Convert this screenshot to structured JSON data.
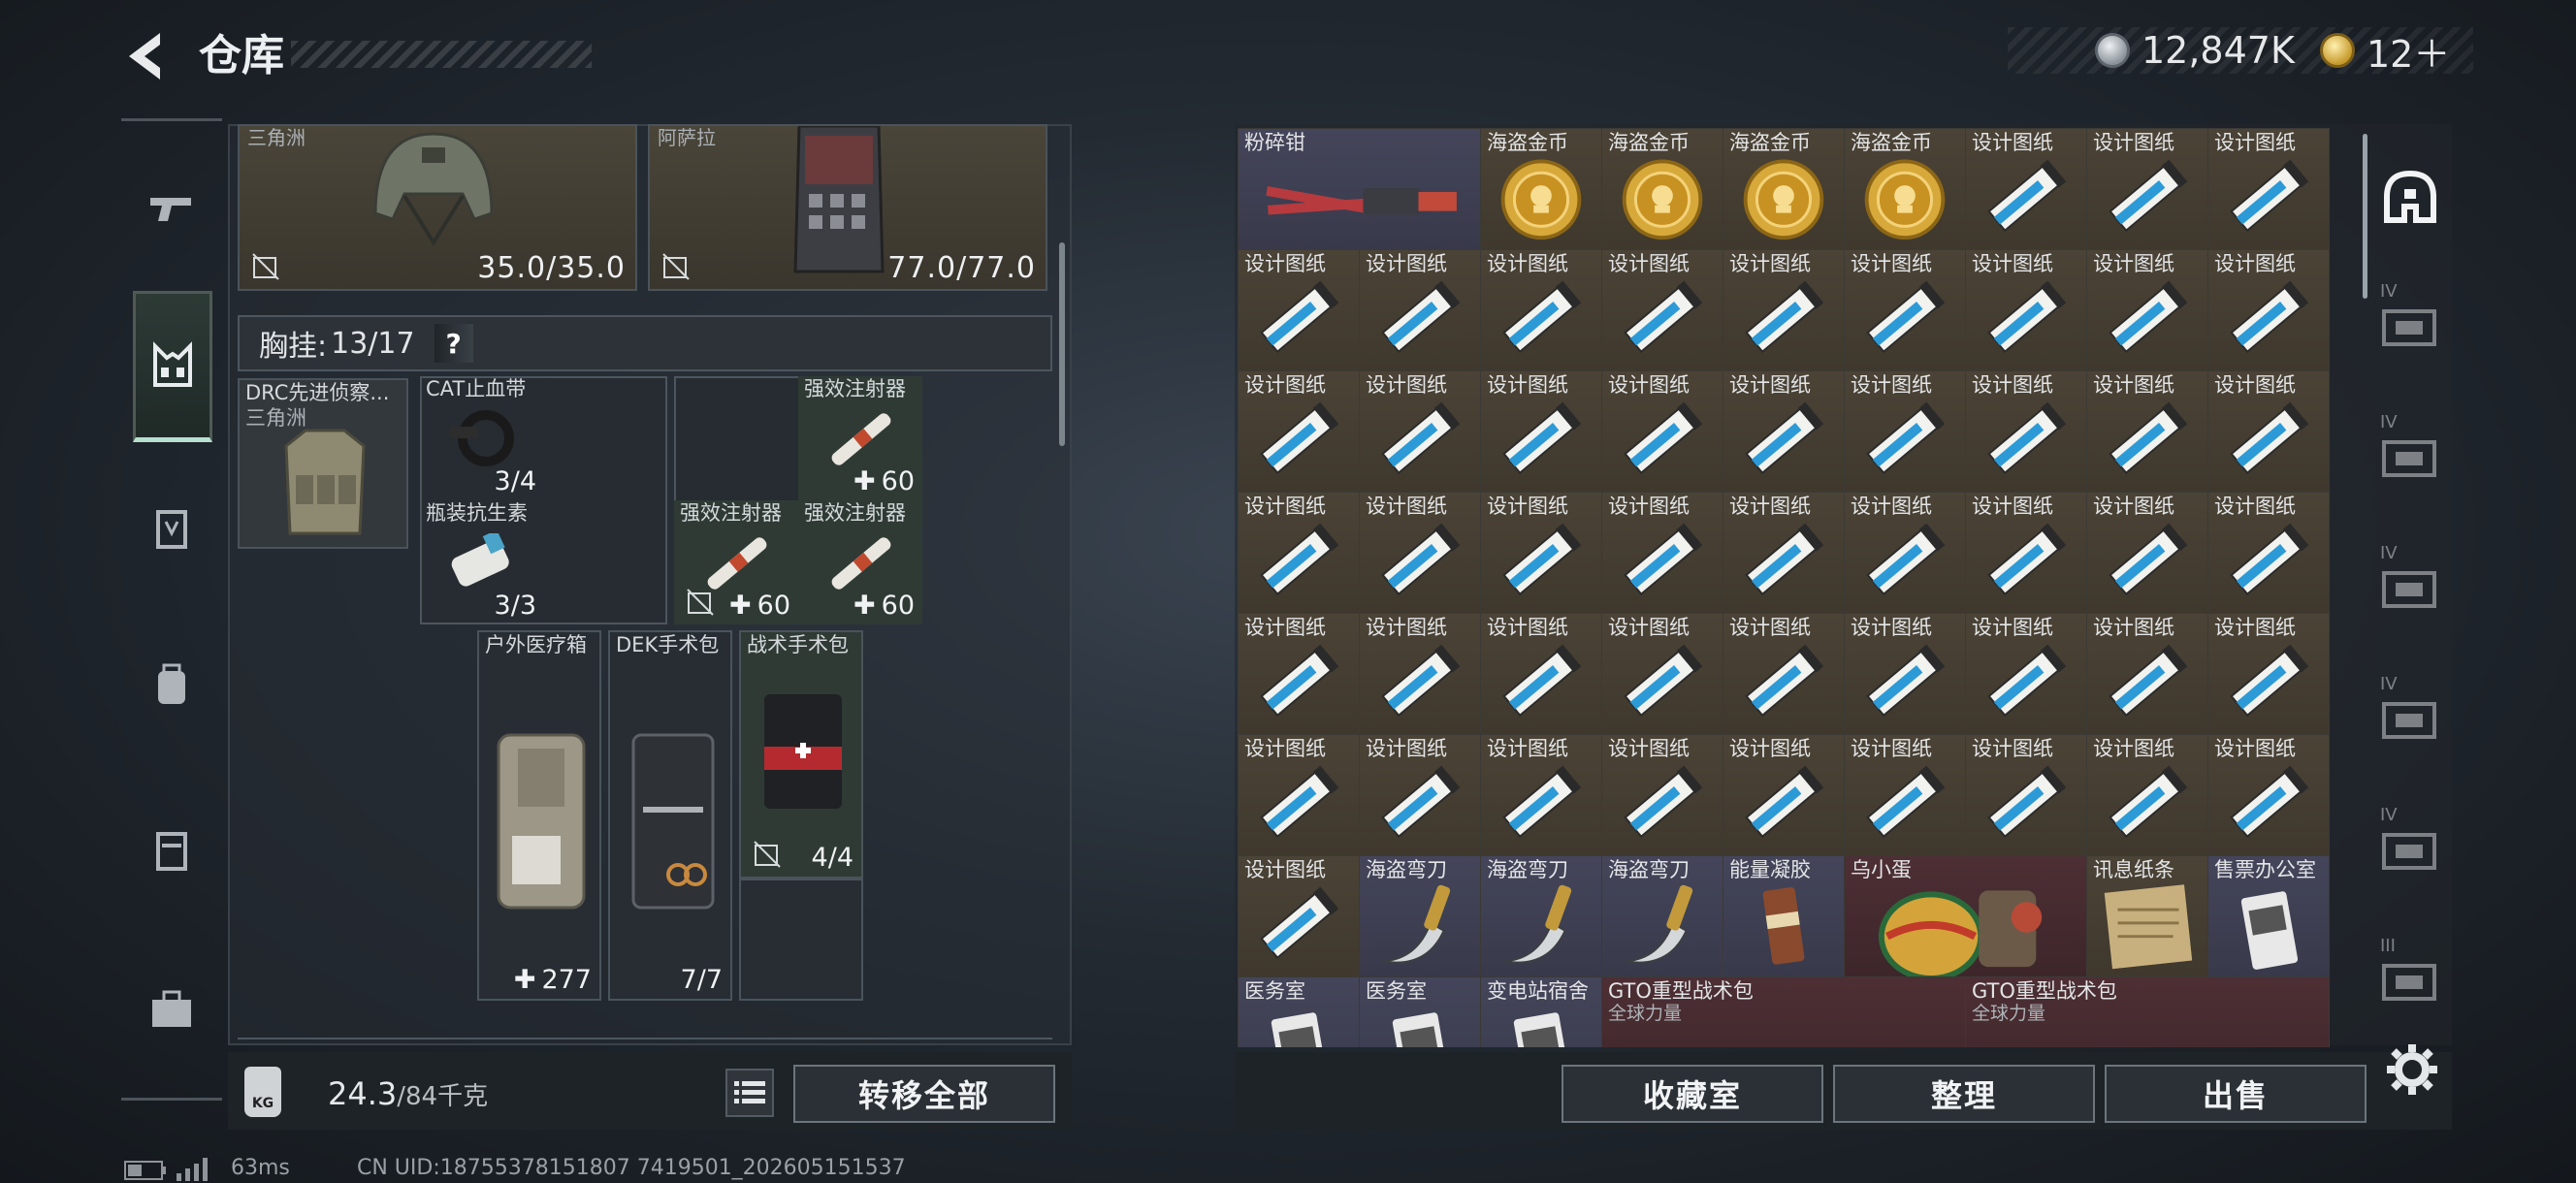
{
  "header": {
    "title": "仓库",
    "currency_silver": "12,847K",
    "currency_gold": "12＋"
  },
  "gear": {
    "helmet_map": "三角洲",
    "helmet_durability": "35.0/35.0",
    "armor_map": "阿萨拉",
    "armor_durability": "77.0/77.0"
  },
  "chest": {
    "header_label": "胸挂:",
    "header_capacity": "13/17",
    "help": "?",
    "rig_name": "DRC先进侦察...",
    "rig_map": "三角洲"
  },
  "items": {
    "cat_name": "CAT止血带",
    "cat_count": "3/4",
    "inj1_name": "强效注射器",
    "inj1_count": "60",
    "antibiotic_name": "瓶装抗生素",
    "antibiotic_count": "3/3",
    "inj2_name": "强效注射器",
    "inj2_count": "60",
    "inj3_name": "强效注射器",
    "inj3_count": "60",
    "medkit_name": "户外医疗箱",
    "medkit_count": "277",
    "dek_name": "DEK手术包",
    "dek_count": "7/7",
    "tactical_name": "战术手术包",
    "tactical_count": "4/4"
  },
  "bottom": {
    "weight_icon": "KG",
    "weight_current": "24.3",
    "weight_max": "/84千克",
    "transfer_all": "转移全部"
  },
  "storage": {
    "cells": [
      {
        "r": 0,
        "c": 0,
        "w": 2,
        "label": "粉碎钳",
        "icon": "crusher",
        "bg": "purple"
      },
      {
        "r": 0,
        "c": 2,
        "label": "海盗金币",
        "icon": "coin"
      },
      {
        "r": 0,
        "c": 3,
        "label": "海盗金币",
        "icon": "coin"
      },
      {
        "r": 0,
        "c": 4,
        "label": "海盗金币",
        "icon": "coin"
      },
      {
        "r": 0,
        "c": 5,
        "label": "海盗金币",
        "icon": "coin"
      },
      {
        "r": 0,
        "c": 6,
        "label": "设计图纸",
        "icon": "blueprint"
      },
      {
        "r": 0,
        "c": 7,
        "label": "设计图纸",
        "icon": "blueprint"
      },
      {
        "r": 0,
        "c": 8,
        "label": "设计图纸",
        "icon": "blueprint"
      },
      {
        "r": 1,
        "c": 0,
        "label": "设计图纸",
        "icon": "blueprint"
      },
      {
        "r": 1,
        "c": 1,
        "label": "设计图纸",
        "icon": "blueprint"
      },
      {
        "r": 1,
        "c": 2,
        "label": "设计图纸",
        "icon": "blueprint"
      },
      {
        "r": 1,
        "c": 3,
        "label": "设计图纸",
        "icon": "blueprint"
      },
      {
        "r": 1,
        "c": 4,
        "label": "设计图纸",
        "icon": "blueprint"
      },
      {
        "r": 1,
        "c": 5,
        "label": "设计图纸",
        "icon": "blueprint"
      },
      {
        "r": 1,
        "c": 6,
        "label": "设计图纸",
        "icon": "blueprint"
      },
      {
        "r": 1,
        "c": 7,
        "label": "设计图纸",
        "icon": "blueprint"
      },
      {
        "r": 1,
        "c": 8,
        "label": "设计图纸",
        "icon": "blueprint"
      },
      {
        "r": 2,
        "c": 0,
        "label": "设计图纸",
        "icon": "blueprint"
      },
      {
        "r": 2,
        "c": 1,
        "label": "设计图纸",
        "icon": "blueprint"
      },
      {
        "r": 2,
        "c": 2,
        "label": "设计图纸",
        "icon": "blueprint"
      },
      {
        "r": 2,
        "c": 3,
        "label": "设计图纸",
        "icon": "blueprint"
      },
      {
        "r": 2,
        "c": 4,
        "label": "设计图纸",
        "icon": "blueprint"
      },
      {
        "r": 2,
        "c": 5,
        "label": "设计图纸",
        "icon": "blueprint"
      },
      {
        "r": 2,
        "c": 6,
        "label": "设计图纸",
        "icon": "blueprint"
      },
      {
        "r": 2,
        "c": 7,
        "label": "设计图纸",
        "icon": "blueprint"
      },
      {
        "r": 2,
        "c": 8,
        "label": "设计图纸",
        "icon": "blueprint"
      },
      {
        "r": 3,
        "c": 0,
        "label": "设计图纸",
        "icon": "blueprint"
      },
      {
        "r": 3,
        "c": 1,
        "label": "设计图纸",
        "icon": "blueprint"
      },
      {
        "r": 3,
        "c": 2,
        "label": "设计图纸",
        "icon": "blueprint"
      },
      {
        "r": 3,
        "c": 3,
        "label": "设计图纸",
        "icon": "blueprint"
      },
      {
        "r": 3,
        "c": 4,
        "label": "设计图纸",
        "icon": "blueprint"
      },
      {
        "r": 3,
        "c": 5,
        "label": "设计图纸",
        "icon": "blueprint"
      },
      {
        "r": 3,
        "c": 6,
        "label": "设计图纸",
        "icon": "blueprint"
      },
      {
        "r": 3,
        "c": 7,
        "label": "设计图纸",
        "icon": "blueprint"
      },
      {
        "r": 3,
        "c": 8,
        "label": "设计图纸",
        "icon": "blueprint"
      },
      {
        "r": 4,
        "c": 0,
        "label": "设计图纸",
        "icon": "blueprint"
      },
      {
        "r": 4,
        "c": 1,
        "label": "设计图纸",
        "icon": "blueprint"
      },
      {
        "r": 4,
        "c": 2,
        "label": "设计图纸",
        "icon": "blueprint"
      },
      {
        "r": 4,
        "c": 3,
        "label": "设计图纸",
        "icon": "blueprint"
      },
      {
        "r": 4,
        "c": 4,
        "label": "设计图纸",
        "icon": "blueprint"
      },
      {
        "r": 4,
        "c": 5,
        "label": "设计图纸",
        "icon": "blueprint"
      },
      {
        "r": 4,
        "c": 6,
        "label": "设计图纸",
        "icon": "blueprint"
      },
      {
        "r": 4,
        "c": 7,
        "label": "设计图纸",
        "icon": "blueprint"
      },
      {
        "r": 4,
        "c": 8,
        "label": "设计图纸",
        "icon": "blueprint"
      },
      {
        "r": 5,
        "c": 0,
        "label": "设计图纸",
        "icon": "blueprint"
      },
      {
        "r": 5,
        "c": 1,
        "label": "设计图纸",
        "icon": "blueprint"
      },
      {
        "r": 5,
        "c": 2,
        "label": "设计图纸",
        "icon": "blueprint"
      },
      {
        "r": 5,
        "c": 3,
        "label": "设计图纸",
        "icon": "blueprint"
      },
      {
        "r": 5,
        "c": 4,
        "label": "设计图纸",
        "icon": "blueprint"
      },
      {
        "r": 5,
        "c": 5,
        "label": "设计图纸",
        "icon": "blueprint"
      },
      {
        "r": 5,
        "c": 6,
        "label": "设计图纸",
        "icon": "blueprint"
      },
      {
        "r": 5,
        "c": 7,
        "label": "设计图纸",
        "icon": "blueprint"
      },
      {
        "r": 5,
        "c": 8,
        "label": "设计图纸",
        "icon": "blueprint"
      },
      {
        "r": 6,
        "c": 0,
        "label": "设计图纸",
        "icon": "blueprint"
      },
      {
        "r": 6,
        "c": 1,
        "label": "海盗弯刀",
        "icon": "knife",
        "bg": "purple"
      },
      {
        "r": 6,
        "c": 2,
        "label": "海盗弯刀",
        "icon": "knife",
        "bg": "purple"
      },
      {
        "r": 6,
        "c": 3,
        "label": "海盗弯刀",
        "icon": "knife",
        "bg": "purple"
      },
      {
        "r": 6,
        "c": 4,
        "label": "能量凝胶",
        "icon": "gel",
        "bg": "purple"
      },
      {
        "r": 6,
        "c": 5,
        "w": 2,
        "label": "乌小蛋",
        "icon": "egg",
        "bg": "red"
      },
      {
        "r": 6,
        "c": 7,
        "label": "讯息纸条",
        "icon": "note"
      },
      {
        "r": 6,
        "c": 8,
        "label": "售票办公室",
        "icon": "card",
        "bg": "purple"
      },
      {
        "r": 7,
        "c": 0,
        "label": "医务室",
        "icon": "card",
        "bg": "purple"
      },
      {
        "r": 7,
        "c": 1,
        "label": "医务室",
        "icon": "card",
        "bg": "purple"
      },
      {
        "r": 7,
        "c": 2,
        "label": "变电站宿舍",
        "icon": "card",
        "bg": "purple"
      },
      {
        "r": 7,
        "c": 3,
        "w": 3,
        "label": "GTO重型战术包",
        "sub": "全球力量",
        "icon": "bag",
        "bg": "red"
      },
      {
        "r": 7,
        "c": 6,
        "w": 3,
        "label": "GTO重型战术包",
        "sub": "全球力量",
        "icon": "bag",
        "bg": "red"
      }
    ],
    "buttons": {
      "collection": "收藏室",
      "sort": "整理",
      "sell": "出售"
    }
  },
  "side_tabs": [
    "IV",
    "IV",
    "IV",
    "IV",
    "IV",
    "III"
  ],
  "footer": {
    "ping": "63ms",
    "uid": "CN UID:18755378151807 7419501_202605151537"
  },
  "colors": {
    "accent": "#b7e0ce",
    "cell_gold": "#4b4336",
    "cell_purple": "#44455a",
    "cell_red": "#4d2f34"
  }
}
